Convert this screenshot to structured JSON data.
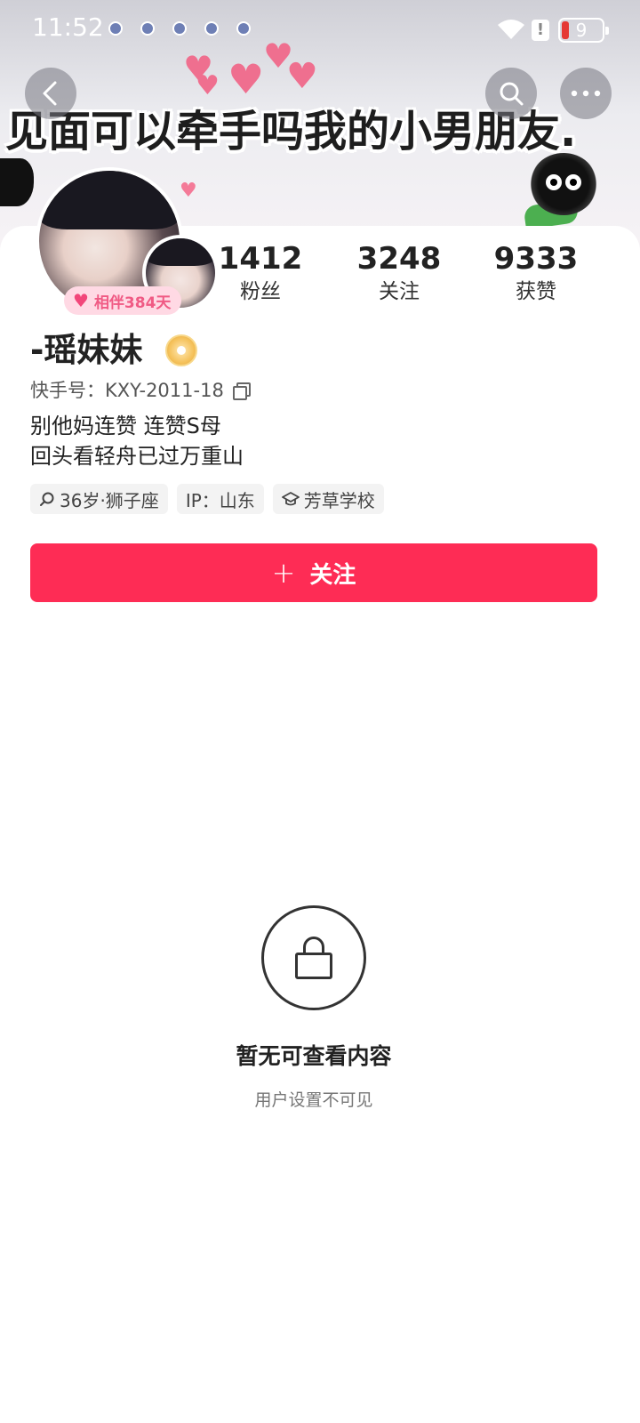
{
  "status_bar": {
    "time": "11:52",
    "battery": "9"
  },
  "banner": {
    "text": "见面可以牵手吗我的小男朋友."
  },
  "profile": {
    "companion_badge": "相伴384天",
    "stats": [
      {
        "value": "1412",
        "label": "粉丝"
      },
      {
        "value": "3248",
        "label": "关注"
      },
      {
        "value": "9333",
        "label": "获赞"
      }
    ],
    "name": "-瑶妹妹",
    "uid": "快手号：KXY-2011-18",
    "bio_line1": "别他妈连赞  连赞S母",
    "bio_line2": "回头看轻舟已过万重山",
    "tags": [
      {
        "icon": "search-icon",
        "text": "36岁·狮子座"
      },
      {
        "icon": "",
        "text": "IP：山东"
      },
      {
        "icon": "graduation-cap-icon",
        "text": "芳草学校"
      }
    ],
    "follow_label": "关注"
  },
  "empty_state": {
    "title": "暂无可查看内容",
    "subtitle": "用户设置不可见"
  },
  "colors": {
    "accent": "#fe2c55",
    "badge_pink": "#ffd9e4"
  }
}
